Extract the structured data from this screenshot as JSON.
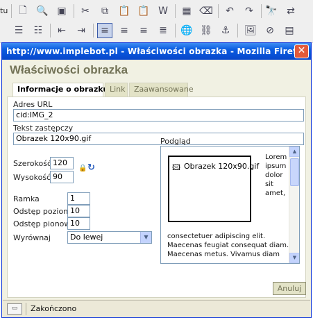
{
  "editor_toolbar": {
    "left_text": "tu",
    "row1": [
      "new-page-icon",
      "preview-icon",
      "templates-icon",
      "cut-icon",
      "copy-icon",
      "paste-icon",
      "paste-text-icon",
      "paste-word-icon",
      "table-icon",
      "eraser-icon",
      "undo-icon",
      "redo-icon",
      "find-icon",
      "replace-icon"
    ],
    "row2": [
      "numbered-list-icon",
      "bulleted-list-icon",
      "outdent-icon",
      "indent-icon",
      "align-left-icon",
      "align-center-icon",
      "align-right-icon",
      "justify-icon",
      "link-icon",
      "unlink-icon",
      "anchor-icon",
      "image-icon",
      "flash-icon",
      "table-props-icon"
    ]
  },
  "window": {
    "title": "http://www.implebot.pl - Właściwości obrazka - Mozilla Firefox",
    "close_symbol": "✕"
  },
  "dialog": {
    "title": "Właściwości obrazka",
    "tabs": [
      {
        "label": "Informacje o obrazku",
        "selected": true
      },
      {
        "label": "Link",
        "selected": false
      },
      {
        "label": "Zaawansowane",
        "selected": false
      }
    ],
    "url_label": "Adres URL",
    "url_value": "cid:IMG_2",
    "alt_label": "Tekst zastępczy",
    "alt_value": "Obrazek 120x90.gif",
    "width_label": "Szerokość",
    "width_value": "120",
    "height_label": "Wysokość",
    "height_value": "90",
    "border_label": "Ramka",
    "border_value": "1",
    "hspace_label": "Odstęp poziomy",
    "hspace_value": "10",
    "vspace_label": "Odstęp pionowy",
    "vspace_value": "10",
    "align_label": "Wyrównaj",
    "align_value": "Do lewej",
    "preview_label": "Podgląd",
    "preview_alt": "Obrazek 120x90.gif",
    "preview_side_lines": [
      "Lorem",
      "ipsum",
      "dolor",
      "sit",
      "amet,"
    ],
    "preview_bottom_lines": [
      "consectetuer adipiscing elit.",
      "Maecenas feugiat consequat diam.",
      "Maecenas metus. Vivamus diam"
    ],
    "cancel_label": "Anuluj"
  },
  "statusbar": {
    "text": "Zakończono"
  },
  "colors": {
    "titlebar": "#0a5be0",
    "dialog_bg": "#f1f1e3",
    "tab_bg": "#e3e3c7",
    "input_border": "#7f9db9"
  }
}
